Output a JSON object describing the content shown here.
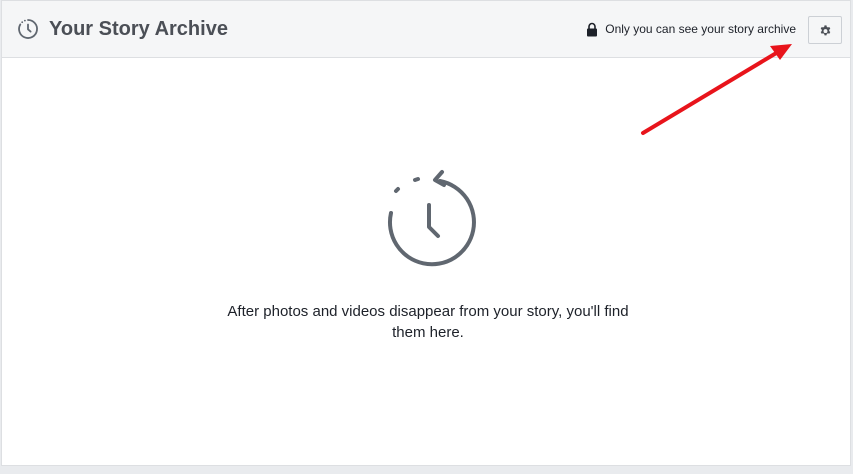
{
  "header": {
    "title": "Your Story Archive",
    "privacy_text": "Only you can see your story archive",
    "settings_icon": "gear-icon",
    "header_icon": "archive-clock-icon",
    "lock_icon": "lock-icon"
  },
  "empty_state": {
    "icon": "archive-clock-icon",
    "message": "After photos and videos disappear from your story, you'll find them here."
  },
  "colors": {
    "header_bg": "#f5f6f7",
    "title": "#4b4f56",
    "icon": "#606770",
    "annotation_arrow": "#e8141b"
  }
}
